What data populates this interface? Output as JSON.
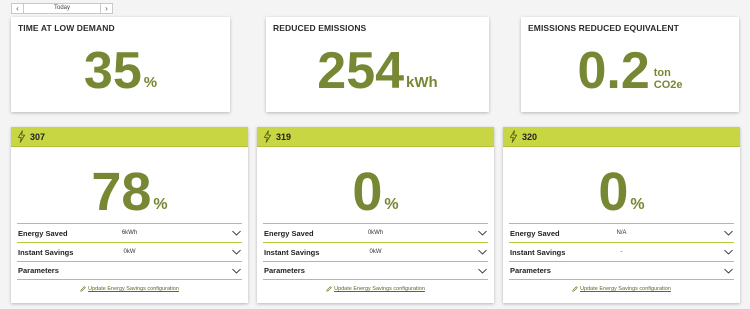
{
  "date_nav": {
    "prev_icon": "chevron-left",
    "label": "Today",
    "next_icon": "chevron-right"
  },
  "kpis": [
    {
      "title": "TIME AT LOW DEMAND",
      "value": "35",
      "unit": "%"
    },
    {
      "title": "REDUCED EMISSIONS",
      "value": "254",
      "unit": "kWh"
    },
    {
      "title": "EMISSIONS REDUCED EQUIVALENT",
      "value": "0.2",
      "unit_line1": "ton",
      "unit_line2": "CO2e"
    }
  ],
  "cards": [
    {
      "device": "307",
      "value": "78",
      "unit": "%",
      "rows": [
        {
          "label": "Energy Saved",
          "value": "6kWh"
        },
        {
          "label": "Instant Savings",
          "value": "0kW"
        },
        {
          "label": "Parameters",
          "value": ""
        }
      ],
      "link": "Update Energy Savings configuration"
    },
    {
      "device": "319",
      "value": "0",
      "unit": "%",
      "rows": [
        {
          "label": "Energy Saved",
          "value": "0kWh"
        },
        {
          "label": "Instant Savings",
          "value": "0kW"
        },
        {
          "label": "Parameters",
          "value": ""
        }
      ],
      "link": "Update Energy Savings configuration"
    },
    {
      "device": "320",
      "value": "0",
      "unit": "%",
      "rows": [
        {
          "label": "Energy Saved",
          "value": "N/A"
        },
        {
          "label": "Instant Savings",
          "value": "-"
        },
        {
          "label": "Parameters",
          "value": ""
        }
      ],
      "link": "Update Energy Savings configuration"
    }
  ],
  "colors": {
    "accent": "#c7d642",
    "value_green": "#768833",
    "divider": "#b8c93b",
    "background": "#f4f4f4"
  },
  "icons": {
    "device": "lightning-bolt-icon",
    "row_toggle": "chevron-down-icon",
    "link": "pencil-icon"
  }
}
